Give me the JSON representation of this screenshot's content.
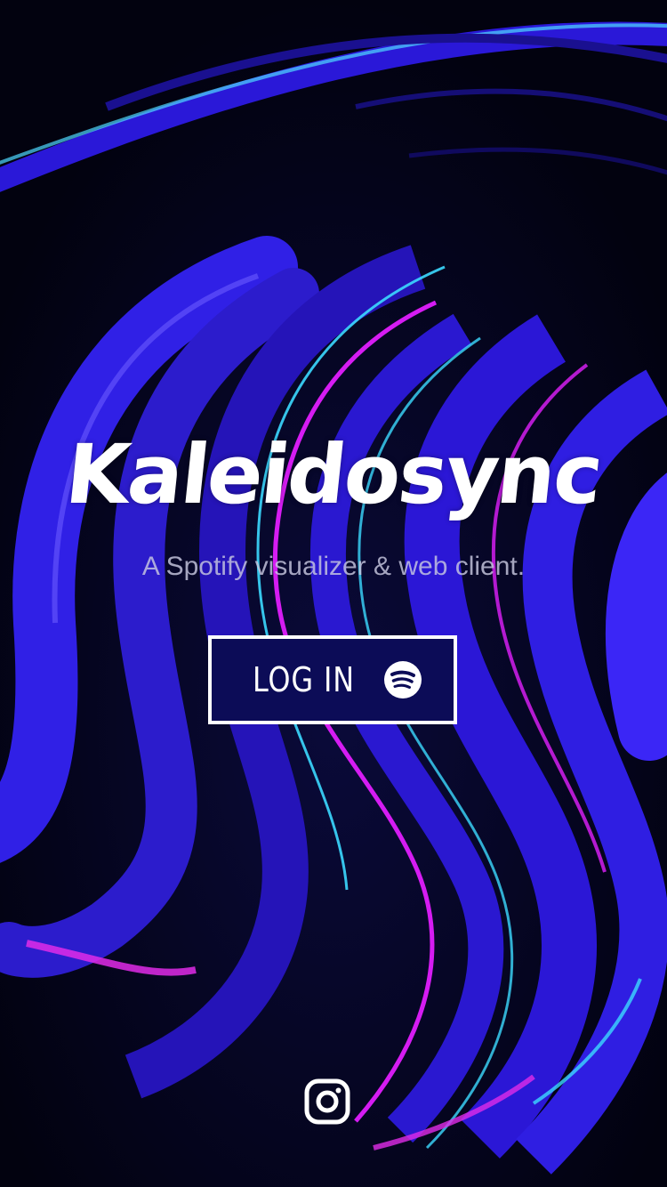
{
  "app": {
    "title": "Kaleidosync",
    "tagline": "A Spotify visualizer & web client."
  },
  "login_button": {
    "label": "LOG IN",
    "icon": "spotify-icon"
  },
  "footer": {
    "social_icon": "instagram-icon"
  },
  "colors": {
    "background": "#02020f",
    "accent_blue": "#3a22f5",
    "accent_cyan": "#38d8ff",
    "accent_magenta": "#d51cf2",
    "button_fill": "#0c0c57",
    "text": "#ffffff"
  }
}
